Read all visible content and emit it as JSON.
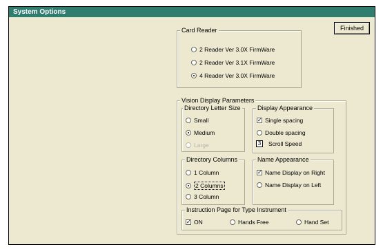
{
  "window": {
    "title": "System Options"
  },
  "finished_label": "Finished",
  "card_reader": {
    "label": "Card Reader",
    "options": [
      {
        "label": "2 Reader Ver 3.0X FirmWare",
        "selected": false
      },
      {
        "label": "2 Reader Ver 3.1X FirmWare",
        "selected": false
      },
      {
        "label": "4 Reader Ver 3.0X FirmWare",
        "selected": true
      }
    ]
  },
  "vision": {
    "label": "Vision Display Parameters",
    "letter_size": {
      "label": "Directory Letter Size",
      "options": [
        {
          "label": "Small",
          "selected": false
        },
        {
          "label": "Medium",
          "selected": true
        },
        {
          "label": "Large",
          "selected": false
        }
      ]
    },
    "appearance": {
      "label": "Display Appearance",
      "single": {
        "label": "Single spacing",
        "checked": true
      },
      "double": {
        "label": "Double spacing",
        "checked": false
      },
      "scroll_label": "Scroll Speed",
      "scroll_value": "3"
    },
    "columns": {
      "label": "Directory Columns",
      "options": [
        {
          "label": "1 Column",
          "selected": false
        },
        {
          "label": "2 Columns",
          "selected": true
        },
        {
          "label": "3 Column",
          "selected": false
        }
      ]
    },
    "name_appearance": {
      "label": "Name Appearance",
      "options": [
        {
          "label": "Name Display on Right",
          "selected": true
        },
        {
          "label": "Name Display on Left",
          "selected": false
        }
      ]
    },
    "instruction": {
      "label": "Instruction Page for Type Instrument",
      "options": [
        {
          "label": "ON",
          "selected": true
        },
        {
          "label": "Hands Free",
          "selected": false
        },
        {
          "label": "Hand Set",
          "selected": false
        }
      ]
    }
  }
}
